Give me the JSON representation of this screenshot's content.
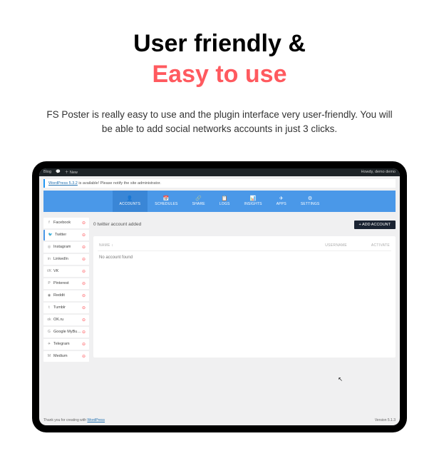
{
  "hero": {
    "title1": "User friendly &",
    "title2": "Easy to use",
    "desc": "FS Poster is really easy to use and the plugin interface very user-friendly. You will be able to add social networks accounts in just 3 clicks."
  },
  "wpbar": {
    "blog": "Blog",
    "new": "＋ New",
    "howdy": "Howdy, demo demo"
  },
  "notice": {
    "link": "WordPress 5.3.2",
    "text": " is available! Please notify the site administrator."
  },
  "nav": {
    "accounts": "ACCOUNTS",
    "schedules": "SCHEDULES",
    "share": "SHARE",
    "logs": "LOGS",
    "insights": "INSIGHTS",
    "apps": "APPS",
    "settings": "SETTINGS"
  },
  "sidebar": {
    "items": [
      {
        "label": "Facebook"
      },
      {
        "label": "Twitter"
      },
      {
        "label": "Instagram"
      },
      {
        "label": "LinkedIn"
      },
      {
        "label": "VK"
      },
      {
        "label": "Pinterest"
      },
      {
        "label": "Reddit"
      },
      {
        "label": "Tumblr"
      },
      {
        "label": "OK.ru"
      },
      {
        "label": "Google MyBusiness"
      },
      {
        "label": "Telegram"
      },
      {
        "label": "Medium"
      }
    ]
  },
  "main": {
    "title": "0 twitter account added",
    "add_btn": "+ ADD ACCOUNT",
    "col_name": "NAME ↕",
    "col_username": "USERNAME",
    "col_activate": "ACTIVATE",
    "empty": "No account found"
  },
  "footer": {
    "thanks": "Thank you for creating with ",
    "wp": "WordPress",
    "version": "Version 5.1.3"
  }
}
